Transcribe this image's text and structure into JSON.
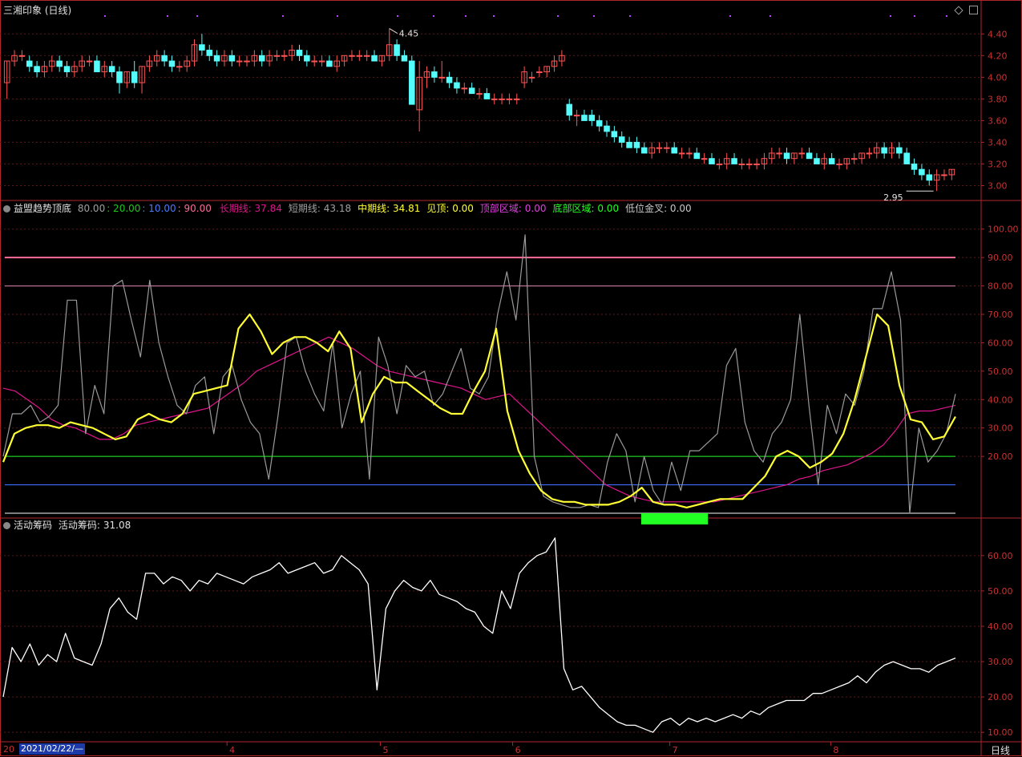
{
  "colors": {
    "background": "#000000",
    "frame": "#b0272b",
    "grid": "#5a1a1a",
    "up": "#ff5555",
    "down": "#54fcfc",
    "short_line": "#9a9a9a",
    "mid_line": "#ffff33",
    "long_line": "#e0148c",
    "level_90": "#ff6b9a",
    "level_80": "#c878a0",
    "level_20": "#1ec81e",
    "level_10": "#3a6cff",
    "level_0": "#c8c8c8",
    "bottom_zone": "#22ff22",
    "chips_line": "#ffffff",
    "axis_text": "#c83232"
  },
  "main_panel": {
    "title": "三湘印象 (日线)",
    "high_label": "4.45",
    "low_label": "2.95",
    "y_ticks": [
      "4.40",
      "4.20",
      "4.00",
      "3.80",
      "3.60",
      "3.40",
      "3.20",
      "3.00"
    ]
  },
  "indicator_panel": {
    "name": "益盟趋势顶底",
    "params": [
      {
        "text": "80.00",
        "color": "#a0a0a0"
      },
      {
        "text": ": 20.00",
        "color": "#1ec81e"
      },
      {
        "text": ": 10.00",
        "color": "#4a7cff"
      },
      {
        "text": ": 90.00",
        "color": "#ff6b9a"
      }
    ],
    "values": [
      {
        "label": "长期线:",
        "value": "37.84",
        "color": "#e0148c"
      },
      {
        "label": "短期线:",
        "value": "43.18",
        "color": "#a0a0a0"
      },
      {
        "label": "中期线:",
        "value": "34.81",
        "color": "#ffff33"
      },
      {
        "label": "见顶:",
        "value": "0.00",
        "color": "#ffff33"
      },
      {
        "label": "顶部区域:",
        "value": "0.00",
        "color": "#e040e0"
      },
      {
        "label": "底部区域:",
        "value": "0.00",
        "color": "#22ff22"
      },
      {
        "label": "低位金叉:",
        "value": "0.00",
        "color": "#c8c8c8"
      }
    ],
    "y_ticks": [
      "100.00",
      "90.00",
      "80.00",
      "70.00",
      "60.00",
      "50.00",
      "40.00",
      "30.00",
      "20.00"
    ]
  },
  "chips_panel": {
    "name": "活动筹码",
    "label": "活动筹码:",
    "value": "31.08",
    "y_ticks": [
      "60.00",
      "50.00",
      "40.00",
      "30.00",
      "20.00",
      "10.00"
    ]
  },
  "x_axis": {
    "cursor_date": "2021/02/22/—",
    "partial_label": "20",
    "months": [
      "4",
      "5",
      "6",
      "7",
      "8"
    ],
    "period": "日线"
  },
  "chart_data": [
    {
      "type": "candlestick",
      "name": "三湘印象 (日线)",
      "ylim": [
        2.9,
        4.55
      ],
      "high": 4.45,
      "low": 2.95,
      "candles": [
        [
          3.95,
          4.15,
          3.8,
          4.15
        ],
        [
          4.15,
          4.25,
          4.1,
          4.2
        ],
        [
          4.2,
          4.25,
          4.15,
          4.2
        ],
        [
          4.15,
          4.2,
          4.05,
          4.1
        ],
        [
          4.1,
          4.15,
          4.0,
          4.05
        ],
        [
          4.05,
          4.15,
          4.0,
          4.1
        ],
        [
          4.1,
          4.2,
          4.05,
          4.15
        ],
        [
          4.15,
          4.2,
          4.05,
          4.1
        ],
        [
          4.1,
          4.15,
          4.0,
          4.05
        ],
        [
          4.05,
          4.15,
          4.0,
          4.1
        ],
        [
          4.1,
          4.2,
          4.05,
          4.15
        ],
        [
          4.15,
          4.2,
          4.1,
          4.15
        ],
        [
          4.15,
          4.2,
          4.05,
          4.05
        ],
        [
          4.05,
          4.15,
          4.0,
          4.1
        ],
        [
          4.1,
          4.15,
          4.0,
          4.05
        ],
        [
          4.05,
          4.1,
          3.85,
          3.95
        ],
        [
          3.95,
          4.05,
          3.9,
          4.05
        ],
        [
          4.05,
          4.15,
          3.9,
          3.95
        ],
        [
          3.95,
          4.1,
          3.85,
          4.1
        ],
        [
          4.1,
          4.2,
          4.05,
          4.15
        ],
        [
          4.15,
          4.25,
          4.1,
          4.2
        ],
        [
          4.2,
          4.25,
          4.1,
          4.15
        ],
        [
          4.15,
          4.2,
          4.05,
          4.1
        ],
        [
          4.1,
          4.15,
          4.05,
          4.1
        ],
        [
          4.1,
          4.2,
          4.05,
          4.15
        ],
        [
          4.15,
          4.35,
          4.1,
          4.3
        ],
        [
          4.3,
          4.4,
          4.2,
          4.25
        ],
        [
          4.25,
          4.3,
          4.15,
          4.2
        ],
        [
          4.2,
          4.25,
          4.1,
          4.15
        ],
        [
          4.15,
          4.25,
          4.1,
          4.2
        ],
        [
          4.2,
          4.25,
          4.1,
          4.15
        ],
        [
          4.15,
          4.2,
          4.1,
          4.15
        ],
        [
          4.15,
          4.2,
          4.1,
          4.15
        ],
        [
          4.15,
          4.25,
          4.1,
          4.2
        ],
        [
          4.2,
          4.25,
          4.1,
          4.15
        ],
        [
          4.15,
          4.25,
          4.1,
          4.2
        ],
        [
          4.2,
          4.25,
          4.15,
          4.2
        ],
        [
          4.2,
          4.25,
          4.15,
          4.2
        ],
        [
          4.2,
          4.3,
          4.15,
          4.25
        ],
        [
          4.25,
          4.3,
          4.15,
          4.2
        ],
        [
          4.2,
          4.25,
          4.1,
          4.15
        ],
        [
          4.15,
          4.2,
          4.1,
          4.15
        ],
        [
          4.15,
          4.2,
          4.1,
          4.15
        ],
        [
          4.15,
          4.2,
          4.1,
          4.1
        ],
        [
          4.1,
          4.2,
          4.05,
          4.15
        ],
        [
          4.15,
          4.2,
          4.1,
          4.2
        ],
        [
          4.2,
          4.25,
          4.15,
          4.2
        ],
        [
          4.2,
          4.25,
          4.15,
          4.2
        ],
        [
          4.2,
          4.25,
          4.15,
          4.2
        ],
        [
          4.2,
          4.25,
          4.15,
          4.15
        ],
        [
          4.15,
          4.2,
          4.1,
          4.2
        ],
        [
          4.2,
          4.45,
          4.15,
          4.3
        ],
        [
          4.3,
          4.35,
          4.15,
          4.2
        ],
        [
          4.2,
          4.25,
          4.15,
          4.15
        ],
        [
          4.15,
          4.2,
          3.75,
          3.75
        ],
        [
          3.7,
          4.15,
          3.5,
          4.0
        ],
        [
          4.0,
          4.1,
          3.9,
          4.05
        ],
        [
          4.05,
          4.1,
          3.95,
          4.0
        ],
        [
          4.0,
          4.15,
          3.95,
          4.0
        ],
        [
          4.0,
          4.05,
          3.9,
          3.95
        ],
        [
          3.95,
          4.0,
          3.85,
          3.9
        ],
        [
          3.9,
          3.95,
          3.85,
          3.9
        ],
        [
          3.9,
          3.95,
          3.85,
          3.85
        ],
        [
          3.85,
          3.9,
          3.8,
          3.85
        ],
        [
          3.85,
          3.9,
          3.8,
          3.8
        ],
        [
          3.8,
          3.85,
          3.75,
          3.8
        ],
        [
          3.8,
          3.85,
          3.75,
          3.8
        ],
        [
          3.8,
          3.85,
          3.75,
          3.8
        ],
        [
          3.8,
          3.85,
          3.75,
          3.8
        ],
        [
          3.95,
          4.1,
          3.9,
          4.05
        ],
        [
          4.0,
          4.05,
          3.95,
          4.0
        ],
        [
          4.05,
          4.1,
          4.0,
          4.05
        ],
        [
          4.05,
          4.1,
          4.0,
          4.1
        ],
        [
          4.1,
          4.2,
          4.05,
          4.15
        ],
        [
          4.15,
          4.25,
          4.1,
          4.2
        ],
        [
          3.75,
          3.8,
          3.6,
          3.65
        ],
        [
          3.65,
          3.7,
          3.55,
          3.65
        ],
        [
          3.65,
          3.7,
          3.6,
          3.6
        ],
        [
          3.65,
          3.7,
          3.55,
          3.6
        ],
        [
          3.6,
          3.65,
          3.5,
          3.55
        ],
        [
          3.55,
          3.6,
          3.45,
          3.5
        ],
        [
          3.5,
          3.55,
          3.4,
          3.45
        ],
        [
          3.45,
          3.5,
          3.35,
          3.4
        ],
        [
          3.4,
          3.45,
          3.35,
          3.35
        ],
        [
          3.4,
          3.45,
          3.3,
          3.35
        ],
        [
          3.35,
          3.4,
          3.3,
          3.3
        ],
        [
          3.3,
          3.4,
          3.25,
          3.35
        ],
        [
          3.35,
          3.4,
          3.3,
          3.35
        ],
        [
          3.35,
          3.4,
          3.3,
          3.35
        ],
        [
          3.35,
          3.4,
          3.3,
          3.3
        ],
        [
          3.3,
          3.35,
          3.25,
          3.3
        ],
        [
          3.3,
          3.35,
          3.25,
          3.3
        ],
        [
          3.3,
          3.35,
          3.25,
          3.25
        ],
        [
          3.25,
          3.3,
          3.2,
          3.25
        ],
        [
          3.25,
          3.3,
          3.2,
          3.2
        ],
        [
          3.2,
          3.25,
          3.15,
          3.2
        ],
        [
          3.2,
          3.3,
          3.15,
          3.25
        ],
        [
          3.25,
          3.3,
          3.2,
          3.2
        ],
        [
          3.2,
          3.25,
          3.15,
          3.2
        ],
        [
          3.2,
          3.25,
          3.15,
          3.2
        ],
        [
          3.2,
          3.25,
          3.15,
          3.2
        ],
        [
          3.2,
          3.3,
          3.15,
          3.25
        ],
        [
          3.25,
          3.35,
          3.2,
          3.3
        ],
        [
          3.3,
          3.35,
          3.25,
          3.3
        ],
        [
          3.3,
          3.35,
          3.2,
          3.25
        ],
        [
          3.25,
          3.3,
          3.2,
          3.3
        ],
        [
          3.3,
          3.35,
          3.25,
          3.3
        ],
        [
          3.3,
          3.35,
          3.25,
          3.25
        ],
        [
          3.25,
          3.3,
          3.2,
          3.2
        ],
        [
          3.2,
          3.3,
          3.15,
          3.25
        ],
        [
          3.25,
          3.3,
          3.2,
          3.2
        ],
        [
          3.2,
          3.25,
          3.15,
          3.2
        ],
        [
          3.2,
          3.25,
          3.15,
          3.25
        ],
        [
          3.25,
          3.3,
          3.2,
          3.25
        ],
        [
          3.25,
          3.3,
          3.2,
          3.3
        ],
        [
          3.3,
          3.35,
          3.25,
          3.3
        ],
        [
          3.3,
          3.4,
          3.25,
          3.35
        ],
        [
          3.35,
          3.4,
          3.25,
          3.3
        ],
        [
          3.3,
          3.4,
          3.25,
          3.35
        ],
        [
          3.35,
          3.4,
          3.25,
          3.3
        ],
        [
          3.3,
          3.35,
          3.2,
          3.2
        ],
        [
          3.2,
          3.25,
          3.1,
          3.15
        ],
        [
          3.15,
          3.2,
          3.05,
          3.1
        ],
        [
          3.1,
          3.15,
          3.0,
          3.05
        ],
        [
          3.05,
          3.15,
          2.95,
          3.1
        ],
        [
          3.1,
          3.15,
          3.05,
          3.1
        ],
        [
          3.1,
          3.15,
          3.05,
          3.15
        ]
      ]
    },
    {
      "type": "line",
      "name": "益盟趋势顶底",
      "ylim": [
        0,
        105
      ],
      "levels": [
        90,
        80,
        20,
        10,
        0
      ],
      "series": [
        {
          "name": "短期线",
          "values": [
            20,
            35,
            35,
            38,
            32,
            34,
            38,
            75,
            75,
            28,
            45,
            35,
            80,
            82,
            68,
            55,
            82,
            60,
            48,
            38,
            35,
            45,
            48,
            28,
            48,
            52,
            40,
            32,
            28,
            12,
            34,
            60,
            62,
            50,
            42,
            36,
            60,
            30,
            42,
            50,
            12,
            62,
            52,
            35,
            52,
            48,
            50,
            38,
            42,
            50,
            58,
            44,
            42,
            48,
            70,
            85,
            68,
            98,
            20,
            6,
            4,
            3,
            2,
            2,
            3,
            2,
            18,
            28,
            22,
            4,
            20,
            8,
            3,
            18,
            8,
            22,
            22,
            25,
            28,
            52,
            58,
            32,
            22,
            18,
            28,
            32,
            40,
            70,
            38,
            10,
            38,
            28,
            42,
            38,
            50,
            72,
            72,
            85,
            68,
            0,
            30,
            18,
            22,
            28,
            42
          ]
        },
        {
          "name": "中期线",
          "values": [
            18,
            28,
            30,
            31,
            31,
            30,
            32,
            31,
            30,
            28,
            26,
            27,
            33,
            35,
            33,
            32,
            35,
            42,
            43,
            44,
            45,
            65,
            70,
            64,
            56,
            60,
            62,
            62,
            60,
            57,
            64,
            58,
            32,
            42,
            48,
            46,
            46,
            43,
            40,
            37,
            35,
            35,
            43,
            50,
            65,
            36,
            22,
            14,
            8,
            5,
            4,
            4,
            3,
            3,
            3,
            4,
            6,
            9,
            4,
            3,
            3,
            2,
            3,
            4,
            5,
            5,
            5,
            9,
            13,
            20,
            22,
            20,
            16,
            18,
            21,
            28,
            40,
            55,
            70,
            66,
            45,
            33,
            32,
            26,
            27,
            34
          ]
        },
        {
          "name": "长期线",
          "values": [
            44,
            43,
            40,
            37,
            33,
            31,
            30,
            28,
            26,
            26,
            28,
            31,
            32,
            33,
            34,
            35,
            36,
            37,
            40,
            43,
            46,
            50,
            52,
            54,
            56,
            58,
            60,
            62,
            60,
            58,
            55,
            52,
            50,
            49,
            48,
            47,
            46,
            45,
            44,
            42,
            40,
            41,
            42,
            38,
            34,
            30,
            26,
            22,
            18,
            14,
            10,
            8,
            6,
            5,
            4,
            4,
            4,
            4,
            4,
            4,
            5,
            6,
            7,
            8,
            9,
            10,
            12,
            13,
            15,
            16,
            17,
            19,
            21,
            24,
            29,
            35,
            36,
            36,
            37,
            38
          ]
        }
      ],
      "bottom_zone_x": [
        0.67,
        0.74
      ]
    },
    {
      "type": "line",
      "name": "活动筹码",
      "ylim": [
        8,
        67
      ],
      "series": [
        {
          "name": "活动筹码",
          "values": [
            20,
            34,
            30,
            35,
            29,
            32,
            30,
            38,
            31,
            30,
            29,
            35,
            45,
            48,
            44,
            42,
            55,
            55,
            52,
            54,
            53,
            50,
            53,
            52,
            55,
            54,
            53,
            52,
            54,
            55,
            56,
            58,
            55,
            56,
            57,
            58,
            55,
            56,
            60,
            58,
            56,
            52,
            22,
            45,
            50,
            53,
            51,
            50,
            53,
            49,
            48,
            47,
            45,
            44,
            40,
            38,
            50,
            45,
            55,
            58,
            60,
            61,
            65,
            28,
            22,
            23,
            20,
            17,
            15,
            13,
            12,
            12,
            11,
            10,
            13,
            14,
            12,
            14,
            13,
            14,
            13,
            14,
            15,
            14,
            16,
            15,
            17,
            18,
            19,
            19,
            19,
            21,
            21,
            22,
            23,
            24,
            26,
            24,
            27,
            29,
            30,
            29,
            28,
            28,
            27,
            29,
            30,
            31
          ]
        }
      ]
    }
  ]
}
